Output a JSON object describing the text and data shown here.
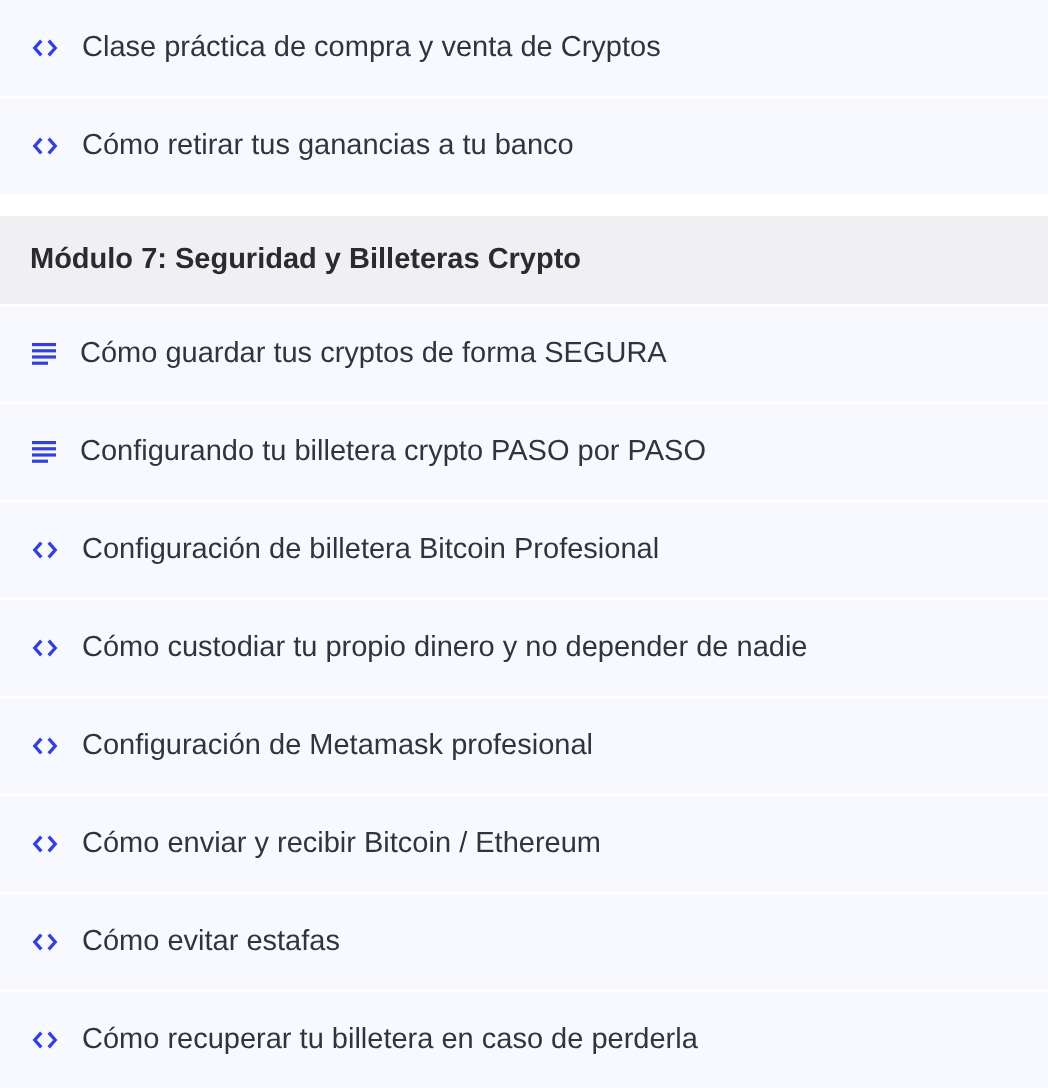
{
  "sections": [
    {
      "items": [
        {
          "kind": "code",
          "title": "Clase práctica de compra y venta de Cryptos"
        },
        {
          "kind": "code",
          "title": "Cómo retirar tus ganancias a tu banco"
        }
      ]
    },
    {
      "title": "Módulo 7: Seguridad y Billeteras Crypto",
      "items": [
        {
          "kind": "text",
          "title": "Cómo guardar tus cryptos de forma SEGURA"
        },
        {
          "kind": "text",
          "title": "Configurando tu billetera crypto PASO por PASO"
        },
        {
          "kind": "code",
          "title": "Configuración de billetera Bitcoin Profesional"
        },
        {
          "kind": "code",
          "title": "Cómo custodiar tu propio dinero y no depender de nadie"
        },
        {
          "kind": "code",
          "title": "Configuración de Metamask profesional"
        },
        {
          "kind": "code",
          "title": "Cómo enviar y recibir Bitcoin / Ethereum"
        },
        {
          "kind": "code",
          "title": "Cómo evitar estafas"
        },
        {
          "kind": "code",
          "title": "Cómo recuperar tu billetera en caso de perderla"
        }
      ]
    }
  ]
}
